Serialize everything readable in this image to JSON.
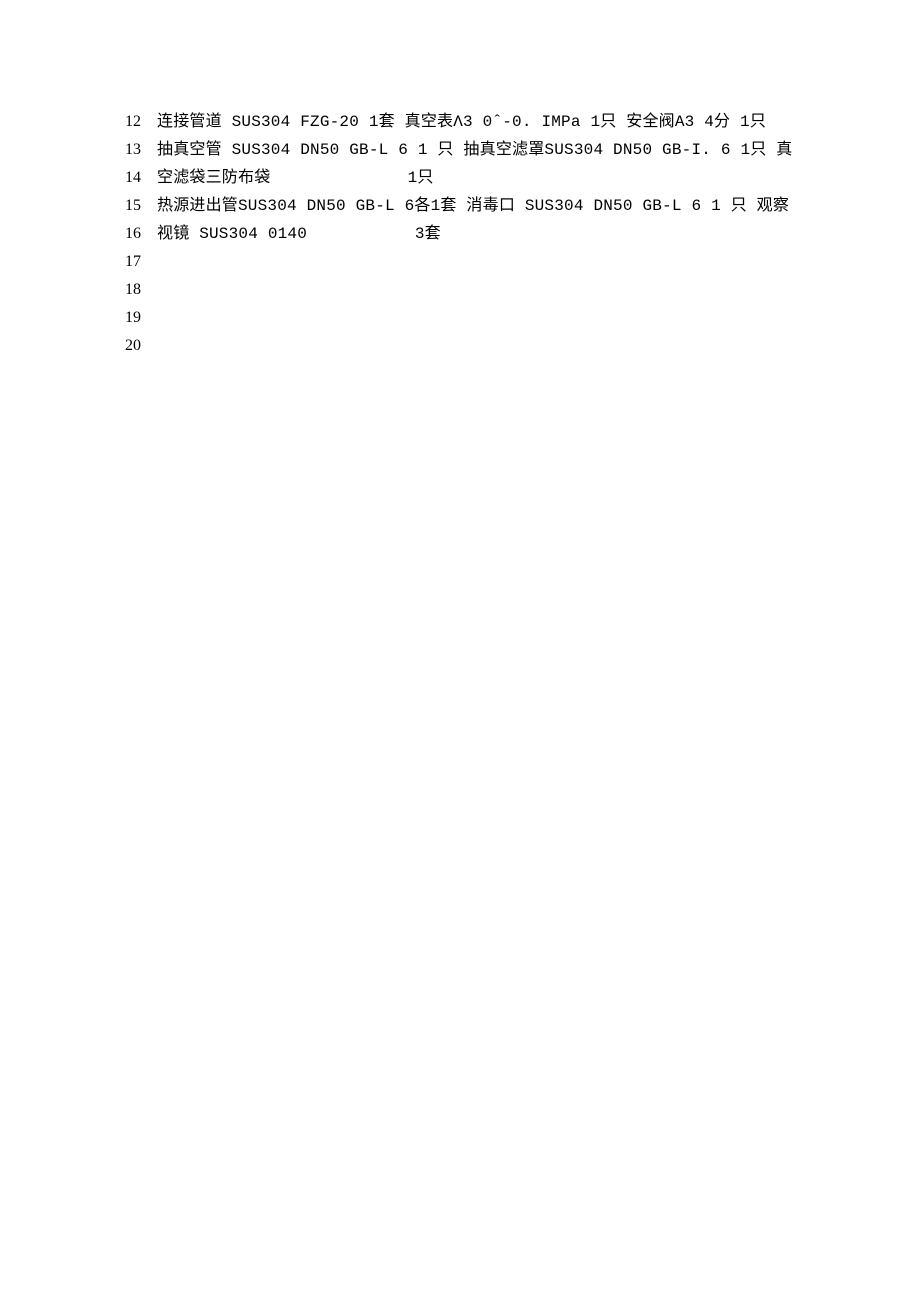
{
  "line_numbers": [
    "12",
    "13",
    "14",
    "15",
    "16",
    "17",
    "18",
    "19",
    "20"
  ],
  "lines": [
    "连接管道 SUS304 FZG-20 1套 真空表Λ3 0ˆ-0. IMPa 1只 安全阀A3 4分 1只",
    "抽真空管 SUS304 DN50 GB-L 6 1 只 抽真空滤罩SUS304 DN50 GB-I. 6 1只 真",
    "空滤袋三防布袋              1只",
    "热源进出管SUS304 DN50 GB-L 6各1套 消毒口 SUS304 DN50 GB-L 6 1 只 观察",
    "视镜 SUS304 0140           3套"
  ]
}
